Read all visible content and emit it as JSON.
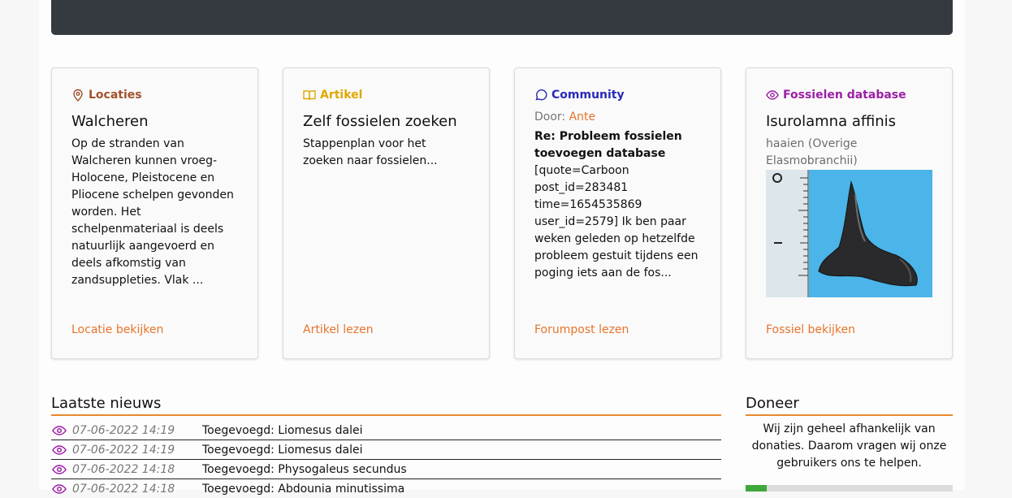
{
  "colors": {
    "accent": "#e8742a",
    "locaties": "#a0522d",
    "artikel": "#e0a800",
    "community": "#2a2ab8",
    "fossielen": "#9b1fa6"
  },
  "cards": [
    {
      "category": "Locaties",
      "icon": "map-pin-icon",
      "title": "Walcheren",
      "body": "Op de stranden van Walcheren kunnen vroeg-Holocene, Pleistocene en Pliocene schelpen gevonden worden. Het schelpenmateriaal is deels natuurlijk aangevoerd en deels afkomstig van zandsuppleties. Vlak ...",
      "link": "Locatie bekijken"
    },
    {
      "category": "Artikel",
      "icon": "book-icon",
      "title": "Zelf fossielen zoeken",
      "body": "Stappenplan voor het zoeken naar fossielen...",
      "link": "Artikel lezen"
    },
    {
      "category": "Community",
      "icon": "chat-bubble-icon",
      "author_label": "Door:",
      "author": "Ante",
      "post_title": "Re: Probleem fossielen toevoegen database",
      "body": "[quote=Carboon post_id=283481 time=1654535869 user_id=2579] Ik ben paar weken geleden op hetzelfde probleem gestuit tijdens een poging iets aan de fos...",
      "link": "Forumpost lezen"
    },
    {
      "category": "Fossielen database",
      "icon": "eye-icon",
      "title": "Isurolamna affinis",
      "subtitle": "haaien (Overige Elasmobranchii)",
      "link": "Fossiel bekijken"
    }
  ],
  "news": {
    "heading": "Laatste nieuws",
    "items": [
      {
        "date": "07-06-2022 14:19",
        "text": "Toegevoegd: Liomesus dalei"
      },
      {
        "date": "07-06-2022 14:19",
        "text": "Toegevoegd: Liomesus dalei"
      },
      {
        "date": "07-06-2022 14:18",
        "text": "Toegevoegd: Physogaleus secundus"
      },
      {
        "date": "07-06-2022 14:18",
        "text": "Toegevoegd: Abdounia minutissima"
      }
    ]
  },
  "donate": {
    "heading": "Doneer",
    "text": "Wij zijn geheel afhankelijk van donaties. Daarom vragen wij onze gebruikers ons te helpen.",
    "progress_fraction": 0.1
  }
}
